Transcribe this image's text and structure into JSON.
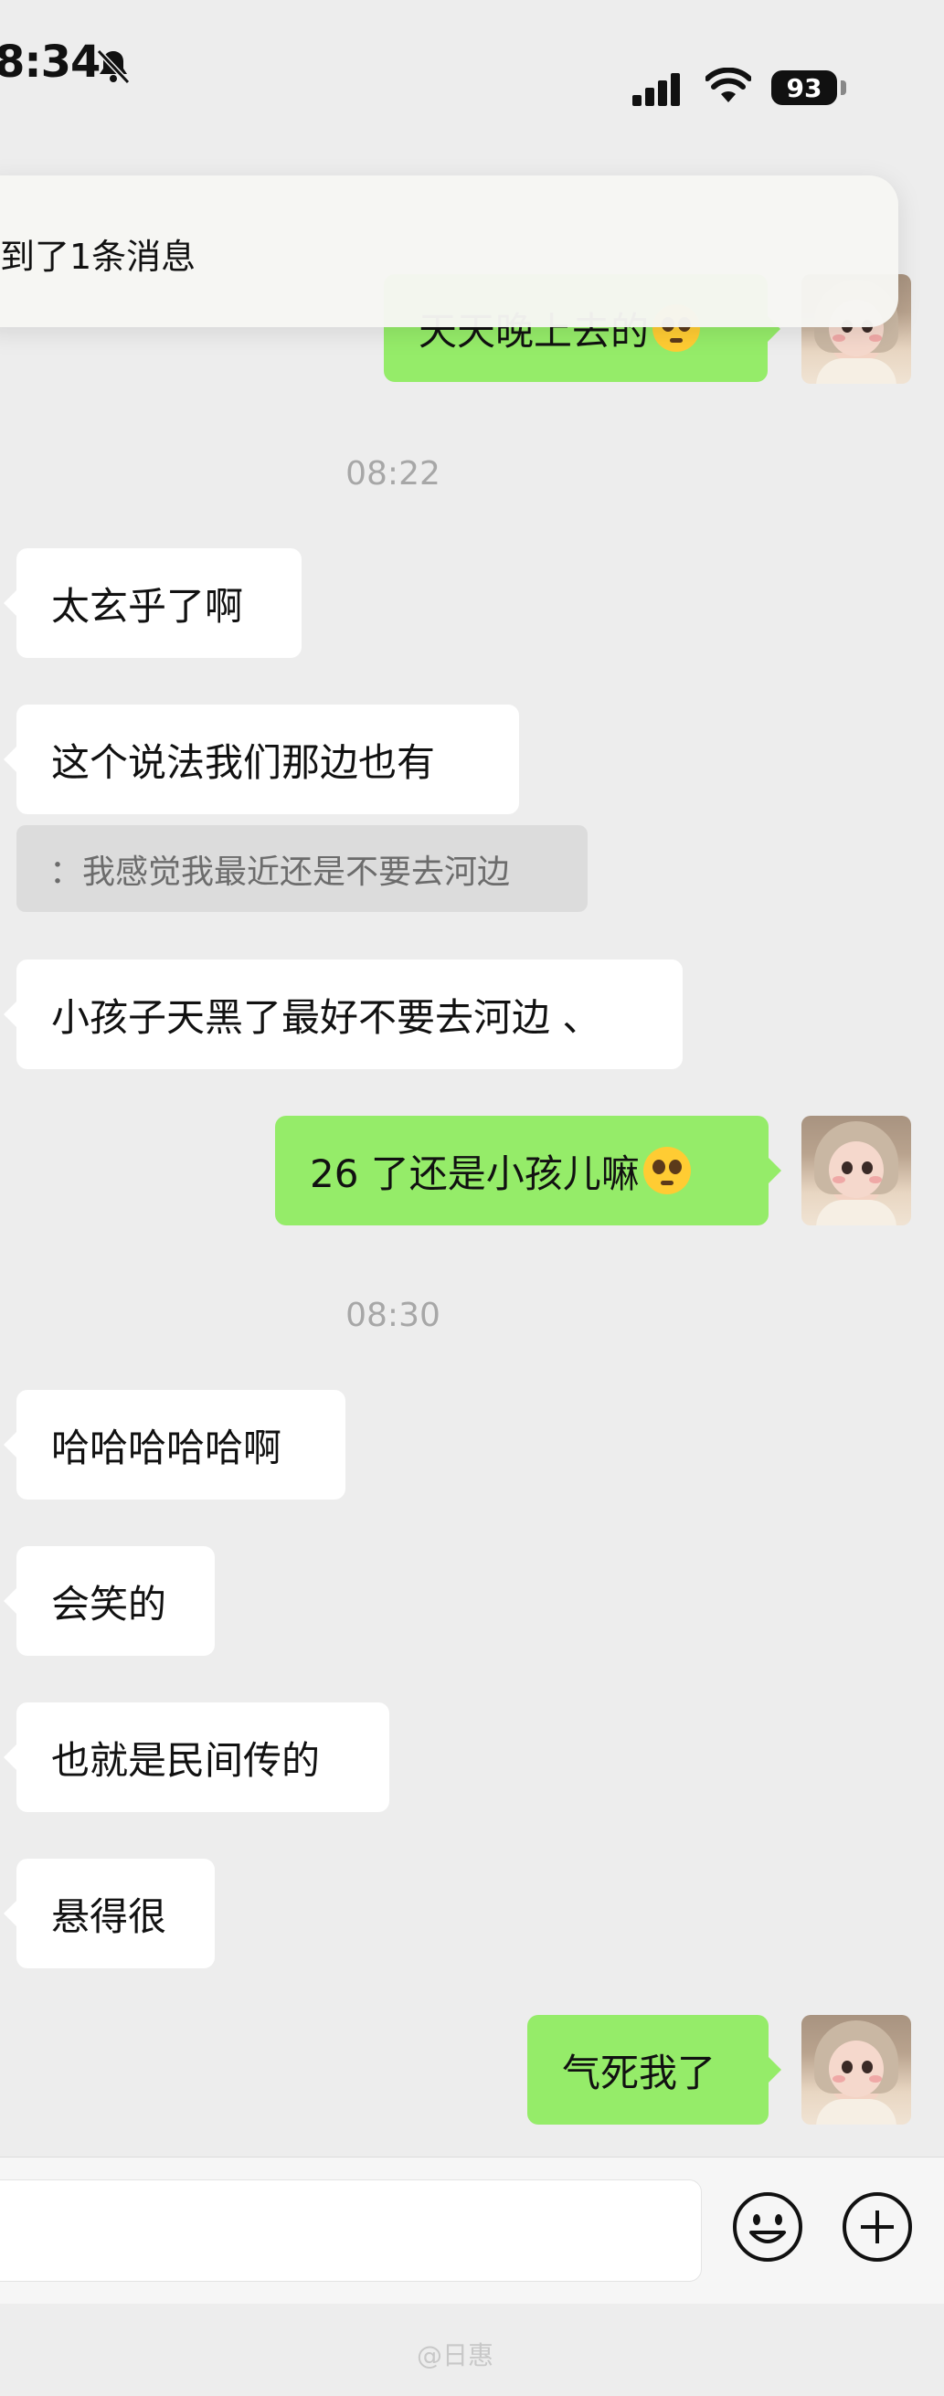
{
  "status_bar": {
    "time": "8:34",
    "battery": "93"
  },
  "notification": {
    "text": "到了1条消息"
  },
  "messages": {
    "partial_top": "天天晚上去的",
    "ts1": "08:22",
    "m1": "太玄乎了啊",
    "m2": "这个说法我们那边也有",
    "quote": "：我感觉我最近还是不要去河边",
    "m3": "小孩子天黑了最好不要去河边 、",
    "m4": "26 了还是小孩儿嘛",
    "ts2": "08:30",
    "m5": "哈哈哈哈哈啊",
    "m6": "会笑的",
    "m7": "也就是民间传的",
    "m8": "悬得很",
    "m9": "气死我了"
  },
  "watermark": "@日惠",
  "icons": [
    "bell-slash-icon",
    "signal-icon",
    "wifi-icon",
    "emoji-button-icon",
    "plus-button-icon"
  ]
}
